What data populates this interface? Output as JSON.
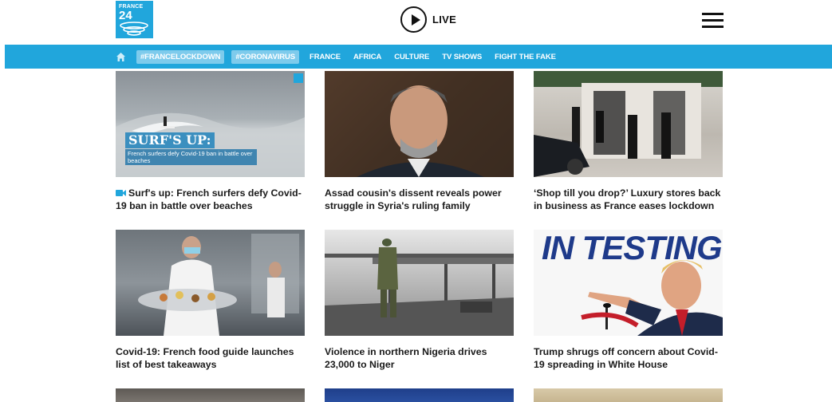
{
  "logo": {
    "line1": "FRANCE",
    "line2": "24"
  },
  "header": {
    "live_label": "LIVE"
  },
  "nav": {
    "hashtags": [
      "#FRANCELOCKDOWN",
      "#CORONAVIRUS"
    ],
    "links": [
      "FRANCE",
      "AFRICA",
      "CULTURE",
      "TV SHOWS",
      "FIGHT THE FAKE"
    ]
  },
  "articles": [
    {
      "title": "Surf's up: French surfers defy Covid-19 ban in battle over beaches",
      "video": true,
      "overlay_head": "SURF'S UP:",
      "overlay_sub": "French surfers defy Covid-19 ban in battle over beaches"
    },
    {
      "title": "Assad cousin's dissent reveals power struggle in Syria's ruling family",
      "video": false
    },
    {
      "title": "‘Shop till you drop?’ Luxury stores back in business as France eases lockdown",
      "video": false
    },
    {
      "title": "Covid-19: French food guide launches list of best takeaways",
      "video": false
    },
    {
      "title": "Violence in northern Nigeria drives 23,000 to Niger",
      "video": false
    },
    {
      "title": "Trump shrugs off concern about Covid-19 spreading in White House",
      "video": false,
      "overlay_head": "IN TESTING"
    }
  ],
  "colors": {
    "brand": "#21a6dc",
    "pill": "#7ecbec"
  }
}
